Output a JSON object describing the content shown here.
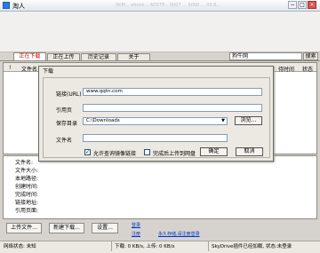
{
  "window": {
    "title": "淘人",
    "faded": "SKM...  ebook... ADSTP... 0007 ... 0000 ... 00.8...",
    "min": "−",
    "max": "□",
    "close": "×"
  },
  "tabs": [
    "正在下载",
    "正在上传",
    "历史记录",
    "关于"
  ],
  "search": {
    "value": "狗牛网",
    "button": "搜索"
  },
  "list": {
    "col_filename": "文件名",
    "col_status": "状态",
    "col_cut": "待时间"
  },
  "detail_labels": [
    "文件名:",
    "文件大小:",
    "本地路径:",
    "创建时间:",
    "完成时间:",
    "链接地址:",
    "引用页面:"
  ],
  "bottom_buttons": [
    "上传文件...",
    "新建下载...",
    "设置..."
  ],
  "bottom_links": {
    "register": "登录",
    "login": "注册",
    "promo": "永久存储,请注册登录"
  },
  "status": {
    "net": "网络状态: 未知",
    "speed": "下载: 0 KB/s, 上传: 0 KB/s",
    "plugin": "SkyDrive插件已经加载, 状态:未登录"
  },
  "dialog": {
    "title": "下载",
    "url_label": "链接(URL)",
    "url_value": "www.qqtn.com",
    "ref_label": "引用页",
    "ref_value": "",
    "dir_label": "保存目录",
    "dir_value": "C:\\Downloads",
    "browse": "浏览...",
    "name_label": "文件名",
    "name_value": "",
    "mirror_label": "允许查询镜像链接",
    "mirror_checked": "✓",
    "shutdown_label": "完成后上传到网盘",
    "ok": "确定",
    "cancel": "取消"
  }
}
